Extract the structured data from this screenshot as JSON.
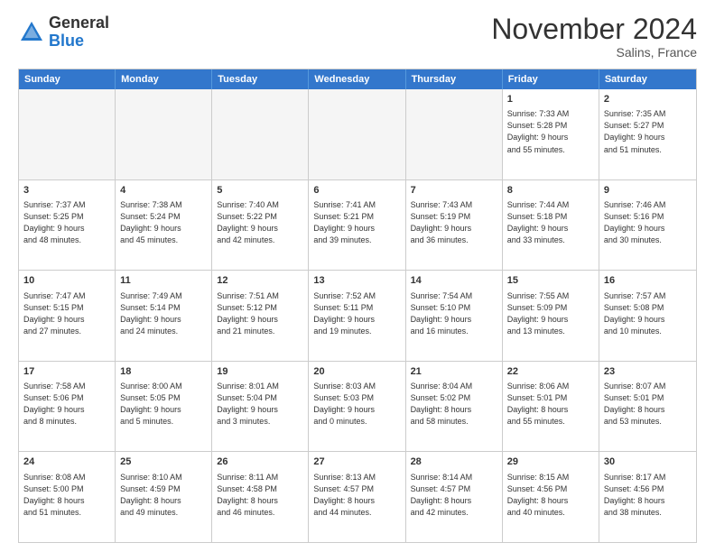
{
  "logo": {
    "general": "General",
    "blue": "Blue"
  },
  "title": "November 2024",
  "location": "Salins, France",
  "weekdays": [
    "Sunday",
    "Monday",
    "Tuesday",
    "Wednesday",
    "Thursday",
    "Friday",
    "Saturday"
  ],
  "weeks": [
    [
      {
        "day": "",
        "info": ""
      },
      {
        "day": "",
        "info": ""
      },
      {
        "day": "",
        "info": ""
      },
      {
        "day": "",
        "info": ""
      },
      {
        "day": "",
        "info": ""
      },
      {
        "day": "1",
        "info": "Sunrise: 7:33 AM\nSunset: 5:28 PM\nDaylight: 9 hours\nand 55 minutes."
      },
      {
        "day": "2",
        "info": "Sunrise: 7:35 AM\nSunset: 5:27 PM\nDaylight: 9 hours\nand 51 minutes."
      }
    ],
    [
      {
        "day": "3",
        "info": "Sunrise: 7:37 AM\nSunset: 5:25 PM\nDaylight: 9 hours\nand 48 minutes."
      },
      {
        "day": "4",
        "info": "Sunrise: 7:38 AM\nSunset: 5:24 PM\nDaylight: 9 hours\nand 45 minutes."
      },
      {
        "day": "5",
        "info": "Sunrise: 7:40 AM\nSunset: 5:22 PM\nDaylight: 9 hours\nand 42 minutes."
      },
      {
        "day": "6",
        "info": "Sunrise: 7:41 AM\nSunset: 5:21 PM\nDaylight: 9 hours\nand 39 minutes."
      },
      {
        "day": "7",
        "info": "Sunrise: 7:43 AM\nSunset: 5:19 PM\nDaylight: 9 hours\nand 36 minutes."
      },
      {
        "day": "8",
        "info": "Sunrise: 7:44 AM\nSunset: 5:18 PM\nDaylight: 9 hours\nand 33 minutes."
      },
      {
        "day": "9",
        "info": "Sunrise: 7:46 AM\nSunset: 5:16 PM\nDaylight: 9 hours\nand 30 minutes."
      }
    ],
    [
      {
        "day": "10",
        "info": "Sunrise: 7:47 AM\nSunset: 5:15 PM\nDaylight: 9 hours\nand 27 minutes."
      },
      {
        "day": "11",
        "info": "Sunrise: 7:49 AM\nSunset: 5:14 PM\nDaylight: 9 hours\nand 24 minutes."
      },
      {
        "day": "12",
        "info": "Sunrise: 7:51 AM\nSunset: 5:12 PM\nDaylight: 9 hours\nand 21 minutes."
      },
      {
        "day": "13",
        "info": "Sunrise: 7:52 AM\nSunset: 5:11 PM\nDaylight: 9 hours\nand 19 minutes."
      },
      {
        "day": "14",
        "info": "Sunrise: 7:54 AM\nSunset: 5:10 PM\nDaylight: 9 hours\nand 16 minutes."
      },
      {
        "day": "15",
        "info": "Sunrise: 7:55 AM\nSunset: 5:09 PM\nDaylight: 9 hours\nand 13 minutes."
      },
      {
        "day": "16",
        "info": "Sunrise: 7:57 AM\nSunset: 5:08 PM\nDaylight: 9 hours\nand 10 minutes."
      }
    ],
    [
      {
        "day": "17",
        "info": "Sunrise: 7:58 AM\nSunset: 5:06 PM\nDaylight: 9 hours\nand 8 minutes."
      },
      {
        "day": "18",
        "info": "Sunrise: 8:00 AM\nSunset: 5:05 PM\nDaylight: 9 hours\nand 5 minutes."
      },
      {
        "day": "19",
        "info": "Sunrise: 8:01 AM\nSunset: 5:04 PM\nDaylight: 9 hours\nand 3 minutes."
      },
      {
        "day": "20",
        "info": "Sunrise: 8:03 AM\nSunset: 5:03 PM\nDaylight: 9 hours\nand 0 minutes."
      },
      {
        "day": "21",
        "info": "Sunrise: 8:04 AM\nSunset: 5:02 PM\nDaylight: 8 hours\nand 58 minutes."
      },
      {
        "day": "22",
        "info": "Sunrise: 8:06 AM\nSunset: 5:01 PM\nDaylight: 8 hours\nand 55 minutes."
      },
      {
        "day": "23",
        "info": "Sunrise: 8:07 AM\nSunset: 5:01 PM\nDaylight: 8 hours\nand 53 minutes."
      }
    ],
    [
      {
        "day": "24",
        "info": "Sunrise: 8:08 AM\nSunset: 5:00 PM\nDaylight: 8 hours\nand 51 minutes."
      },
      {
        "day": "25",
        "info": "Sunrise: 8:10 AM\nSunset: 4:59 PM\nDaylight: 8 hours\nand 49 minutes."
      },
      {
        "day": "26",
        "info": "Sunrise: 8:11 AM\nSunset: 4:58 PM\nDaylight: 8 hours\nand 46 minutes."
      },
      {
        "day": "27",
        "info": "Sunrise: 8:13 AM\nSunset: 4:57 PM\nDaylight: 8 hours\nand 44 minutes."
      },
      {
        "day": "28",
        "info": "Sunrise: 8:14 AM\nSunset: 4:57 PM\nDaylight: 8 hours\nand 42 minutes."
      },
      {
        "day": "29",
        "info": "Sunrise: 8:15 AM\nSunset: 4:56 PM\nDaylight: 8 hours\nand 40 minutes."
      },
      {
        "day": "30",
        "info": "Sunrise: 8:17 AM\nSunset: 4:56 PM\nDaylight: 8 hours\nand 38 minutes."
      }
    ]
  ]
}
